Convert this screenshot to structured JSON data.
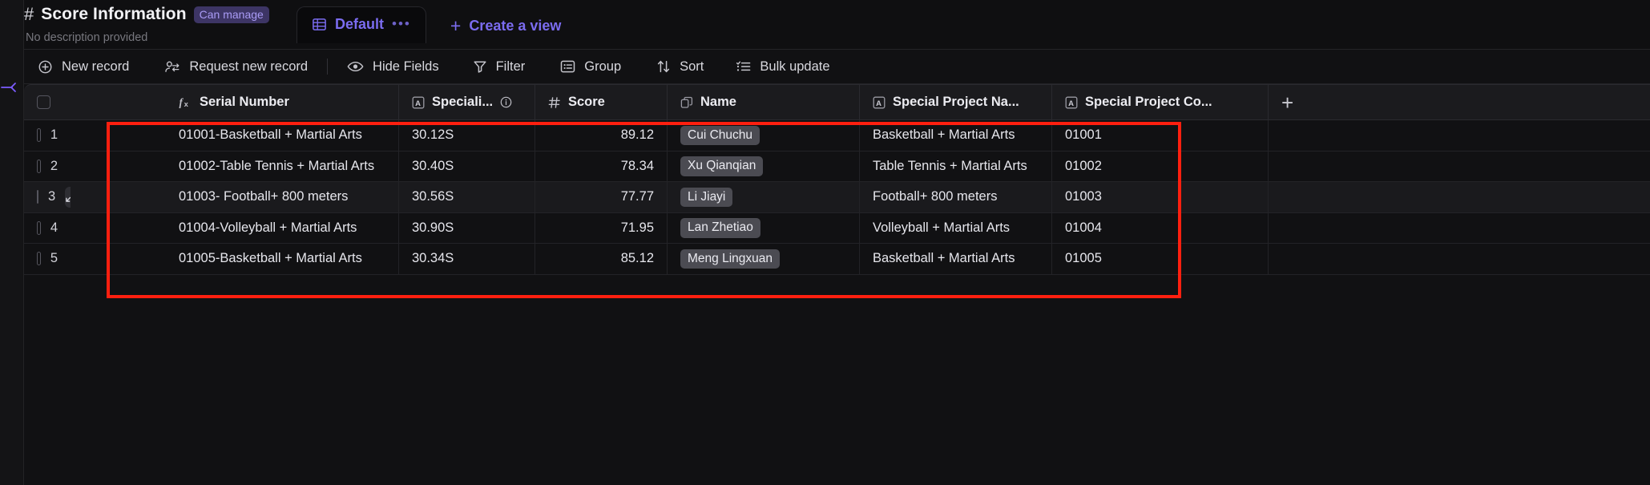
{
  "header": {
    "hash_icon": "hash-icon",
    "title": "Score Information",
    "permission_badge": "Can manage",
    "description": "No description provided",
    "view_tab": {
      "label": "Default",
      "more": "•••",
      "icon": "grid-icon"
    },
    "create_view": {
      "label": "Create a view",
      "plus": "+"
    }
  },
  "toolbar": {
    "items": [
      {
        "label": "New record",
        "icon": "plus-circle-icon"
      },
      {
        "label": "Request new record",
        "icon": "person-request-icon"
      },
      {
        "label": "Hide Fields",
        "icon": "eye-icon"
      },
      {
        "label": "Filter",
        "icon": "funnel-icon"
      },
      {
        "label": "Group",
        "icon": "group-icon"
      },
      {
        "label": "Sort",
        "icon": "sort-arrows-icon"
      },
      {
        "label": "Bulk update",
        "icon": "checklist-icon"
      }
    ]
  },
  "grid": {
    "add_field_button": "+",
    "columns": [
      {
        "key": "serial",
        "label": "Serial Number",
        "type_icon": "formula-icon",
        "info": false
      },
      {
        "key": "spec",
        "label": "Speciali...",
        "type_icon": "text-icon",
        "info": true
      },
      {
        "key": "score",
        "label": "Score",
        "type_icon": "number-icon",
        "info": false
      },
      {
        "key": "name",
        "label": "Name",
        "type_icon": "link-icon",
        "info": false
      },
      {
        "key": "spname",
        "label": "Special Project Na...",
        "type_icon": "text-icon",
        "info": false
      },
      {
        "key": "spcode",
        "label": "Special Project Co...",
        "type_icon": "text-icon",
        "info": false
      }
    ],
    "rows": [
      {
        "n": "1",
        "serial": "01001-Basketball + Martial Arts",
        "spec": "30.12S",
        "score": "89.12",
        "name": "Cui Chuchu",
        "spname": "Basketball + Martial Arts",
        "spcode": "01001"
      },
      {
        "n": "2",
        "serial": "01002-Table Tennis + Martial Arts",
        "spec": "30.40S",
        "score": "78.34",
        "name": "Xu Qianqian",
        "spname": "Table Tennis + Martial Arts",
        "spcode": "01002"
      },
      {
        "n": "3",
        "serial": "01003- Football+ 800 meters",
        "spec": "30.56S",
        "score": "77.77",
        "name": "Li Jiayi",
        "spname": "Football+ 800 meters",
        "spcode": "01003"
      },
      {
        "n": "4",
        "serial": "01004-Volleyball + Martial Arts",
        "spec": "30.90S",
        "score": "71.95",
        "name": "Lan Zhetiao",
        "spname": "Volleyball + Martial Arts",
        "spcode": "01004"
      },
      {
        "n": "5",
        "serial": "01005-Basketball + Martial Arts",
        "spec": "30.34S",
        "score": "85.12",
        "name": "Meng Lingxuan",
        "spname": "Basketball + Martial Arts",
        "spcode": "01005"
      }
    ]
  },
  "colors": {
    "accent": "#7b6cf0",
    "badge_bg": "#3d3565",
    "annotation": "#ff1f0f",
    "page_bg": "#111113"
  }
}
